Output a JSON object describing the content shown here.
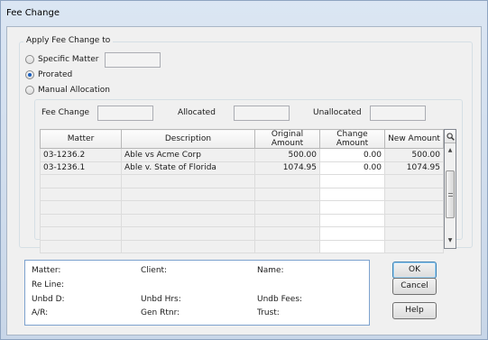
{
  "window": {
    "title": "Fee Change"
  },
  "apply": {
    "group_label": "Apply Fee Change to",
    "options": [
      {
        "label": "Specific Matter",
        "selected": false
      },
      {
        "label": "Prorated",
        "selected": true
      },
      {
        "label": "Manual Allocation",
        "selected": false
      }
    ],
    "specific_matter_value": ""
  },
  "totals": {
    "fee_change_label": "Fee Change",
    "fee_change_value": "",
    "allocated_label": "Allocated",
    "allocated_value": "",
    "unallocated_label": "Unallocated",
    "unallocated_value": ""
  },
  "grid": {
    "columns": [
      "Matter",
      "Description",
      "Original Amount",
      "Change Amount",
      "New Amount"
    ],
    "rows": [
      {
        "matter": "03-1236.2",
        "description": "Able vs Acme Corp",
        "original": "500.00",
        "change": "0.00",
        "new": "500.00"
      },
      {
        "matter": "03-1236.1",
        "description": "Able v. State of Florida",
        "original": "1074.95",
        "change": "0.00",
        "new": "1074.95"
      }
    ],
    "search_icon": "magnifier-icon"
  },
  "info": {
    "matter_label": "Matter:",
    "client_label": "Client:",
    "name_label": "Name:",
    "reline_label": "Re Line:",
    "unbd_label": "Unbd D:",
    "unbd_hrs_label": "Unbd Hrs:",
    "undb_fees_label": "Undb Fees:",
    "ar_label": "A/R:",
    "gen_rtnr_label": "Gen Rtnr:",
    "trust_label": "Trust:"
  },
  "buttons": {
    "ok": "OK",
    "cancel": "Cancel",
    "help": "Help"
  }
}
